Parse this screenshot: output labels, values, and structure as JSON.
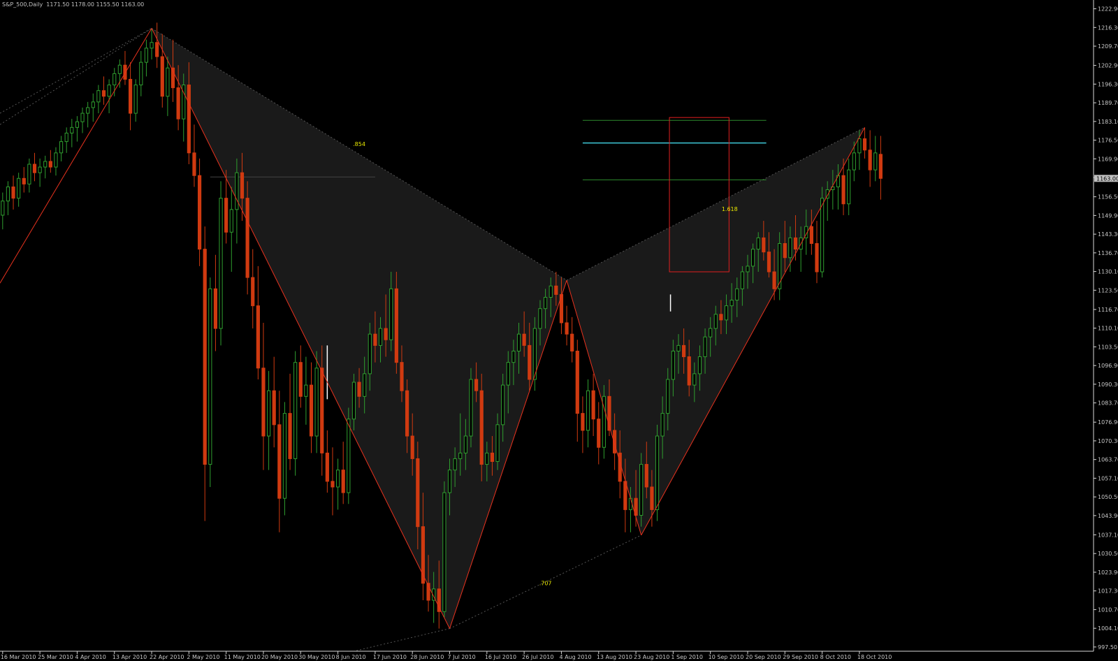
{
  "header": {
    "symbol": "S&P_500,Daily",
    "ohlc": "1171.50 1178.00 1155.50 1163.00"
  },
  "chart_data": {
    "type": "candlestick",
    "title": "S&P_500,Daily",
    "ylim": [
      996.0,
      1226.0
    ],
    "y_ticks": [
      "1222.90",
      "1216.30",
      "1209.70",
      "1202.90",
      "1196.30",
      "1189.70",
      "1183.10",
      "1176.50",
      "1169.90",
      "1163.30",
      "1156.50",
      "1149.90",
      "1143.30",
      "1136.70",
      "1130.10",
      "1123.50",
      "1116.70",
      "1110.10",
      "1103.50",
      "1096.90",
      "1090.30",
      "1083.70",
      "1076.90",
      "1070.30",
      "1063.70",
      "1057.10",
      "1050.50",
      "1043.90",
      "1037.10",
      "1030.50",
      "1023.90",
      "1017.30",
      "1010.70",
      "1004.10",
      "997.50"
    ],
    "current_price": "1163.00",
    "x_ticks": [
      {
        "label": "16 Mar 2010",
        "i": 0
      },
      {
        "label": "25 Mar 2010",
        "i": 7
      },
      {
        "label": "4 Apr 2010",
        "i": 14
      },
      {
        "label": "13 Apr 2010",
        "i": 21
      },
      {
        "label": "22 Apr 2010",
        "i": 28
      },
      {
        "label": "2 May 2010",
        "i": 35
      },
      {
        "label": "11 May 2010",
        "i": 42
      },
      {
        "label": "20 May 2010",
        "i": 49
      },
      {
        "label": "30 May 2010",
        "i": 56
      },
      {
        "label": "8 Jun 2010",
        "i": 63
      },
      {
        "label": "17 Jun 2010",
        "i": 70
      },
      {
        "label": "28 Jun 2010",
        "i": 77
      },
      {
        "label": "7 Jul 2010",
        "i": 84
      },
      {
        "label": "16 Jul 2010",
        "i": 91
      },
      {
        "label": "26 Jul 2010",
        "i": 98
      },
      {
        "label": "4 Aug 2010",
        "i": 105
      },
      {
        "label": "13 Aug 2010",
        "i": 112
      },
      {
        "label": "23 Aug 2010",
        "i": 119
      },
      {
        "label": "1 Sep 2010",
        "i": 126
      },
      {
        "label": "10 Sep 2010",
        "i": 133
      },
      {
        "label": "20 Sep 2010",
        "i": 140
      },
      {
        "label": "29 Sep 2010",
        "i": 147
      },
      {
        "label": "8 Oct 2010",
        "i": 154
      },
      {
        "label": "18 Oct 2010",
        "i": 161
      }
    ],
    "x_range": [
      -0.5,
      205
    ],
    "candles": [
      [
        1150,
        1158,
        1145,
        1155
      ],
      [
        1155,
        1162,
        1150,
        1160
      ],
      [
        1160,
        1164,
        1152,
        1156
      ],
      [
        1156,
        1165,
        1153,
        1163
      ],
      [
        1163,
        1167,
        1158,
        1161
      ],
      [
        1161,
        1170,
        1158,
        1168
      ],
      [
        1168,
        1172,
        1162,
        1165
      ],
      [
        1165,
        1170,
        1160,
        1167
      ],
      [
        1167,
        1171,
        1163,
        1169
      ],
      [
        1169,
        1173,
        1165,
        1167
      ],
      [
        1167,
        1174,
        1164,
        1172
      ],
      [
        1172,
        1178,
        1169,
        1176
      ],
      [
        1176,
        1181,
        1172,
        1179
      ],
      [
        1179,
        1184,
        1174,
        1181
      ],
      [
        1181,
        1185,
        1176,
        1183
      ],
      [
        1183,
        1188,
        1179,
        1186
      ],
      [
        1186,
        1190,
        1181,
        1188
      ],
      [
        1188,
        1193,
        1183,
        1190
      ],
      [
        1190,
        1196,
        1186,
        1194
      ],
      [
        1194,
        1199,
        1189,
        1192
      ],
      [
        1192,
        1198,
        1186,
        1196
      ],
      [
        1196,
        1202,
        1192,
        1200
      ],
      [
        1200,
        1205,
        1195,
        1203
      ],
      [
        1203,
        1208,
        1196,
        1198
      ],
      [
        1198,
        1204,
        1180,
        1186
      ],
      [
        1186,
        1198,
        1183,
        1196
      ],
      [
        1196,
        1208,
        1192,
        1204
      ],
      [
        1204,
        1212,
        1199,
        1209
      ],
      [
        1209,
        1216,
        1205,
        1211
      ],
      [
        1211,
        1218,
        1202,
        1206
      ],
      [
        1206,
        1214,
        1188,
        1192
      ],
      [
        1192,
        1206,
        1185,
        1202
      ],
      [
        1202,
        1212,
        1190,
        1195
      ],
      [
        1195,
        1203,
        1180,
        1184
      ],
      [
        1184,
        1200,
        1176,
        1196
      ],
      [
        1196,
        1204,
        1168,
        1172
      ],
      [
        1172,
        1182,
        1160,
        1164
      ],
      [
        1164,
        1170,
        1132,
        1138
      ],
      [
        1138,
        1146,
        1042,
        1062
      ],
      [
        1062,
        1128,
        1054,
        1124
      ],
      [
        1124,
        1136,
        1102,
        1110
      ],
      [
        1110,
        1162,
        1104,
        1156
      ],
      [
        1156,
        1166,
        1140,
        1144
      ],
      [
        1144,
        1160,
        1130,
        1152
      ],
      [
        1152,
        1170,
        1140,
        1165
      ],
      [
        1165,
        1172,
        1148,
        1156
      ],
      [
        1156,
        1162,
        1122,
        1128
      ],
      [
        1128,
        1138,
        1110,
        1118
      ],
      [
        1118,
        1132,
        1092,
        1096
      ],
      [
        1096,
        1112,
        1060,
        1072
      ],
      [
        1072,
        1095,
        1060,
        1088
      ],
      [
        1088,
        1100,
        1068,
        1076
      ],
      [
        1076,
        1088,
        1038,
        1050
      ],
      [
        1050,
        1084,
        1044,
        1080
      ],
      [
        1080,
        1094,
        1060,
        1064
      ],
      [
        1064,
        1102,
        1058,
        1098
      ],
      [
        1098,
        1104,
        1082,
        1086
      ],
      [
        1086,
        1100,
        1076,
        1090
      ],
      [
        1090,
        1098,
        1066,
        1072
      ],
      [
        1072,
        1102,
        1066,
        1096
      ],
      [
        1096,
        1104,
        1058,
        1066
      ],
      [
        1066,
        1074,
        1052,
        1056
      ],
      [
        1056,
        1068,
        1044,
        1054
      ],
      [
        1054,
        1064,
        1046,
        1060
      ],
      [
        1060,
        1070,
        1048,
        1052
      ],
      [
        1052,
        1082,
        1048,
        1078
      ],
      [
        1078,
        1094,
        1074,
        1091
      ],
      [
        1091,
        1096,
        1082,
        1086
      ],
      [
        1086,
        1100,
        1080,
        1094
      ],
      [
        1094,
        1112,
        1088,
        1108
      ],
      [
        1108,
        1116,
        1098,
        1104
      ],
      [
        1104,
        1114,
        1098,
        1110
      ],
      [
        1110,
        1122,
        1100,
        1106
      ],
      [
        1106,
        1130,
        1102,
        1124
      ],
      [
        1124,
        1130,
        1094,
        1098
      ],
      [
        1098,
        1104,
        1084,
        1088
      ],
      [
        1088,
        1092,
        1066,
        1072
      ],
      [
        1072,
        1080,
        1058,
        1064
      ],
      [
        1064,
        1070,
        1032,
        1040
      ],
      [
        1040,
        1052,
        1014,
        1020
      ],
      [
        1020,
        1030,
        1010,
        1014
      ],
      [
        1014,
        1024,
        1006,
        1018
      ],
      [
        1018,
        1028,
        1004,
        1010
      ],
      [
        1010,
        1056,
        1008,
        1052
      ],
      [
        1052,
        1064,
        1044,
        1060
      ],
      [
        1060,
        1068,
        1054,
        1064
      ],
      [
        1064,
        1080,
        1058,
        1066
      ],
      [
        1066,
        1078,
        1060,
        1072
      ],
      [
        1072,
        1096,
        1068,
        1092
      ],
      [
        1092,
        1098,
        1084,
        1088
      ],
      [
        1088,
        1094,
        1056,
        1062
      ],
      [
        1062,
        1070,
        1056,
        1066
      ],
      [
        1066,
        1072,
        1058,
        1063
      ],
      [
        1063,
        1080,
        1060,
        1076
      ],
      [
        1076,
        1094,
        1070,
        1090
      ],
      [
        1090,
        1102,
        1080,
        1098
      ],
      [
        1098,
        1106,
        1090,
        1102
      ],
      [
        1102,
        1112,
        1094,
        1108
      ],
      [
        1108,
        1116,
        1100,
        1104
      ],
      [
        1104,
        1112,
        1088,
        1092
      ],
      [
        1092,
        1114,
        1088,
        1110
      ],
      [
        1110,
        1120,
        1104,
        1117
      ],
      [
        1117,
        1124,
        1110,
        1121
      ],
      [
        1121,
        1128,
        1114,
        1125
      ],
      [
        1125,
        1130,
        1118,
        1122
      ],
      [
        1122,
        1128,
        1108,
        1112
      ],
      [
        1112,
        1118,
        1104,
        1108
      ],
      [
        1108,
        1114,
        1098,
        1102
      ],
      [
        1102,
        1106,
        1070,
        1080
      ],
      [
        1080,
        1086,
        1066,
        1074
      ],
      [
        1074,
        1092,
        1068,
        1088
      ],
      [
        1088,
        1094,
        1072,
        1078
      ],
      [
        1078,
        1084,
        1062,
        1068
      ],
      [
        1068,
        1090,
        1064,
        1086
      ],
      [
        1086,
        1092,
        1072,
        1074
      ],
      [
        1074,
        1080,
        1060,
        1066
      ],
      [
        1066,
        1074,
        1050,
        1056
      ],
      [
        1056,
        1064,
        1038,
        1046
      ],
      [
        1046,
        1054,
        1038,
        1050
      ],
      [
        1050,
        1060,
        1040,
        1044
      ],
      [
        1044,
        1066,
        1040,
        1062
      ],
      [
        1062,
        1070,
        1050,
        1054
      ],
      [
        1054,
        1060,
        1040,
        1046
      ],
      [
        1046,
        1076,
        1042,
        1072
      ],
      [
        1072,
        1086,
        1064,
        1080
      ],
      [
        1080,
        1096,
        1074,
        1092
      ],
      [
        1092,
        1106,
        1086,
        1102
      ],
      [
        1102,
        1108,
        1094,
        1104
      ],
      [
        1104,
        1110,
        1094,
        1100
      ],
      [
        1100,
        1106,
        1086,
        1090
      ],
      [
        1090,
        1098,
        1084,
        1094
      ],
      [
        1094,
        1104,
        1088,
        1100
      ],
      [
        1100,
        1110,
        1094,
        1107
      ],
      [
        1107,
        1114,
        1100,
        1110
      ],
      [
        1110,
        1118,
        1104,
        1115
      ],
      [
        1115,
        1120,
        1108,
        1113
      ],
      [
        1113,
        1122,
        1108,
        1118
      ],
      [
        1118,
        1126,
        1112,
        1120
      ],
      [
        1120,
        1128,
        1114,
        1124
      ],
      [
        1124,
        1132,
        1118,
        1130
      ],
      [
        1130,
        1136,
        1124,
        1132
      ],
      [
        1132,
        1140,
        1126,
        1138
      ],
      [
        1138,
        1144,
        1130,
        1142
      ],
      [
        1142,
        1148,
        1134,
        1137
      ],
      [
        1137,
        1144,
        1128,
        1130
      ],
      [
        1130,
        1138,
        1120,
        1124
      ],
      [
        1124,
        1144,
        1120,
        1140
      ],
      [
        1140,
        1148,
        1130,
        1135
      ],
      [
        1135,
        1146,
        1130,
        1142
      ],
      [
        1142,
        1150,
        1134,
        1138
      ],
      [
        1138,
        1146,
        1130,
        1142
      ],
      [
        1142,
        1152,
        1136,
        1146
      ],
      [
        1146,
        1152,
        1136,
        1140
      ],
      [
        1140,
        1148,
        1126,
        1130
      ],
      [
        1130,
        1160,
        1128,
        1156
      ],
      [
        1156,
        1162,
        1148,
        1159
      ],
      [
        1159,
        1166,
        1152,
        1160
      ],
      [
        1160,
        1168,
        1152,
        1164
      ],
      [
        1164,
        1170,
        1150,
        1154
      ],
      [
        1154,
        1170,
        1150,
        1166
      ],
      [
        1166,
        1176,
        1162,
        1172
      ],
      [
        1172,
        1180,
        1166,
        1177
      ],
      [
        1177,
        1181,
        1170,
        1173
      ],
      [
        1173,
        1180,
        1160,
        1166
      ],
      [
        1166,
        1178,
        1162,
        1172
      ],
      [
        1171.5,
        1178,
        1155.5,
        1163
      ]
    ],
    "pattern": {
      "points": [
        {
          "i": 28,
          "y": 1216
        },
        {
          "i": 84,
          "y": 1004
        },
        {
          "i": 106,
          "y": 1127
        },
        {
          "i": 120,
          "y": 1037
        },
        {
          "i": 162,
          "y": 1181
        }
      ],
      "labels": [
        ".854",
        "1.618",
        ".707"
      ]
    },
    "levels": [
      {
        "y": 1183.5,
        "color": "#2e8b2e"
      },
      {
        "y": 1175.5,
        "color": "#3ec8d8"
      },
      {
        "y": 1162.5,
        "color": "#2e8b2e"
      }
    ],
    "colors": {
      "up": "#2f9e2f",
      "down": "#d03a10",
      "pattern": "#e8321e",
      "box": "#e02020",
      "fill": "#1a1a1a",
      "axis": "#d8d8d8"
    }
  }
}
